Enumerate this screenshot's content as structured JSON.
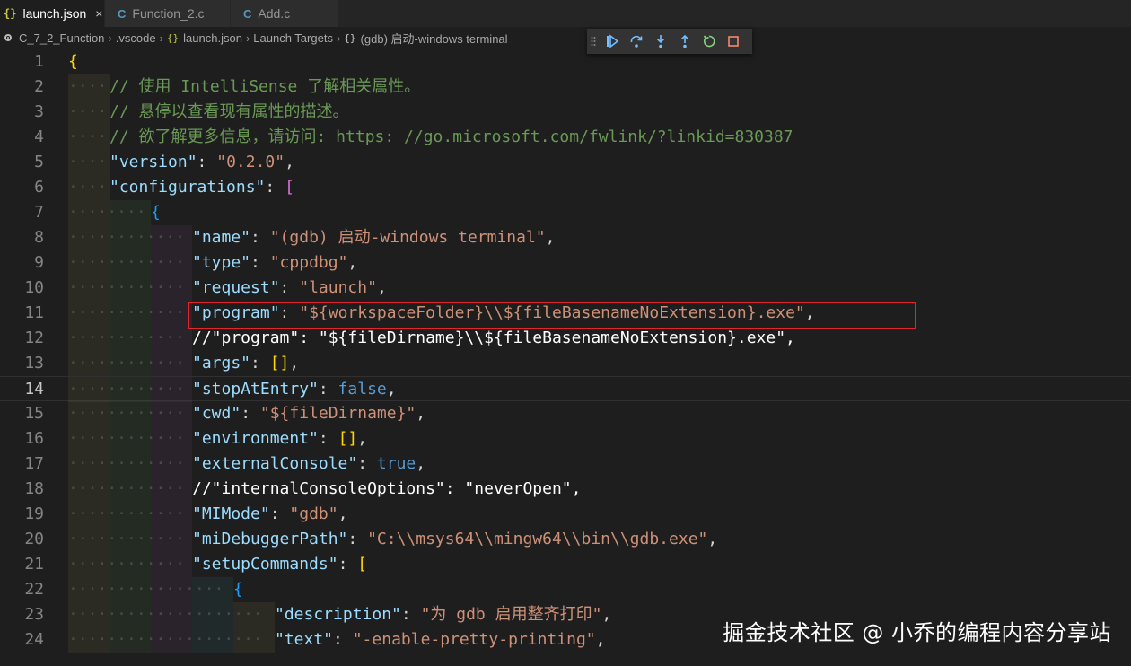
{
  "tabs": [
    {
      "label": "launch.json",
      "icon": "json-braces-icon",
      "icon_glyph": "{}",
      "active": true,
      "close": "×"
    },
    {
      "label": "Function_2.c",
      "icon": "c-file-icon",
      "icon_glyph": "C",
      "active": false
    },
    {
      "label": "Add.c",
      "icon": "c-file-icon",
      "icon_glyph": "C",
      "active": false
    }
  ],
  "breadcrumb": {
    "items": [
      "C_7_2_Function",
      ".vscode",
      "launch.json",
      "Launch Targets",
      "(gdb) 启动-windows terminal"
    ],
    "separator": "›",
    "json_glyph": "{}",
    "obj_glyph": "{}"
  },
  "debug_toolbar": {
    "buttons": [
      "continue",
      "step-over",
      "step-into",
      "step-out",
      "restart",
      "stop"
    ],
    "colors": {
      "blue": "#75beff",
      "green": "#89d185",
      "red": "#f48771"
    }
  },
  "editor": {
    "active_line": 14,
    "highlighted_line": 11,
    "lines": [
      {
        "n": "1",
        "indent": 0,
        "tokens": [
          [
            "b1",
            "{"
          ]
        ]
      },
      {
        "n": "2",
        "indent": 1,
        "tokens": [
          [
            "cm",
            "// 使用 IntelliSense 了解相关属性。"
          ]
        ]
      },
      {
        "n": "3",
        "indent": 1,
        "tokens": [
          [
            "cm",
            "// 悬停以查看现有属性的描述。"
          ]
        ]
      },
      {
        "n": "4",
        "indent": 1,
        "tokens": [
          [
            "cm",
            "// 欲了解更多信息，请访问: https: //go.microsoft.com/fwlink/?linkid=830387"
          ]
        ]
      },
      {
        "n": "5",
        "indent": 1,
        "tokens": [
          [
            "k",
            "\"version\""
          ],
          [
            "p",
            ": "
          ],
          [
            "s",
            "\"0.2.0\""
          ],
          [
            "p",
            ","
          ]
        ]
      },
      {
        "n": "6",
        "indent": 1,
        "tokens": [
          [
            "k",
            "\"configurations\""
          ],
          [
            "p",
            ": "
          ],
          [
            "b2",
            "["
          ]
        ]
      },
      {
        "n": "7",
        "indent": 2,
        "tokens": [
          [
            "b3",
            "{"
          ]
        ]
      },
      {
        "n": "8",
        "indent": 3,
        "tokens": [
          [
            "k",
            "\"name\""
          ],
          [
            "p",
            ": "
          ],
          [
            "s",
            "\"(gdb) 启动-windows terminal\""
          ],
          [
            "p",
            ","
          ]
        ]
      },
      {
        "n": "9",
        "indent": 3,
        "tokens": [
          [
            "k",
            "\"type\""
          ],
          [
            "p",
            ": "
          ],
          [
            "s",
            "\"cppdbg\""
          ],
          [
            "p",
            ","
          ]
        ]
      },
      {
        "n": "10",
        "indent": 3,
        "tokens": [
          [
            "k",
            "\"request\""
          ],
          [
            "p",
            ": "
          ],
          [
            "s",
            "\"launch\""
          ],
          [
            "p",
            ","
          ]
        ]
      },
      {
        "n": "11",
        "indent": 3,
        "tokens": [
          [
            "k",
            "\"program\""
          ],
          [
            "p",
            ": "
          ],
          [
            "s",
            "\"${workspaceFolder}\\\\${fileBasenameNoExtension}.exe\""
          ],
          [
            "p",
            ","
          ]
        ]
      },
      {
        "n": "12",
        "indent": 3,
        "tokens": [
          [
            "wt",
            "//\"program\": \"${fileDirname}\\\\${fileBasenameNoExtension}.exe\","
          ]
        ]
      },
      {
        "n": "13",
        "indent": 3,
        "tokens": [
          [
            "k",
            "\"args\""
          ],
          [
            "p",
            ": "
          ],
          [
            "b1",
            "[]"
          ],
          [
            "p",
            ","
          ]
        ]
      },
      {
        "n": "14",
        "indent": 3,
        "tokens": [
          [
            "k",
            "\"stopAtEntry\""
          ],
          [
            "p",
            ": "
          ],
          [
            "kw",
            "false"
          ],
          [
            "p",
            ","
          ]
        ]
      },
      {
        "n": "15",
        "indent": 3,
        "tokens": [
          [
            "k",
            "\"cwd\""
          ],
          [
            "p",
            ": "
          ],
          [
            "s",
            "\"${fileDirname}\""
          ],
          [
            "p",
            ","
          ]
        ]
      },
      {
        "n": "16",
        "indent": 3,
        "tokens": [
          [
            "k",
            "\"environment\""
          ],
          [
            "p",
            ": "
          ],
          [
            "b1",
            "[]"
          ],
          [
            "p",
            ","
          ]
        ]
      },
      {
        "n": "17",
        "indent": 3,
        "tokens": [
          [
            "k",
            "\"externalConsole\""
          ],
          [
            "p",
            ": "
          ],
          [
            "kw",
            "true"
          ],
          [
            "p",
            ","
          ]
        ]
      },
      {
        "n": "18",
        "indent": 3,
        "tokens": [
          [
            "wt",
            "//\"internalConsoleOptions\": \"neverOpen\","
          ]
        ]
      },
      {
        "n": "19",
        "indent": 3,
        "tokens": [
          [
            "k",
            "\"MIMode\""
          ],
          [
            "p",
            ": "
          ],
          [
            "s",
            "\"gdb\""
          ],
          [
            "p",
            ","
          ]
        ]
      },
      {
        "n": "20",
        "indent": 3,
        "tokens": [
          [
            "k",
            "\"miDebuggerPath\""
          ],
          [
            "p",
            ": "
          ],
          [
            "s",
            "\"C:\\\\msys64\\\\mingw64\\\\bin\\\\gdb.exe\""
          ],
          [
            "p",
            ","
          ]
        ]
      },
      {
        "n": "21",
        "indent": 3,
        "tokens": [
          [
            "k",
            "\"setupCommands\""
          ],
          [
            "p",
            ": "
          ],
          [
            "b1",
            "["
          ]
        ]
      },
      {
        "n": "22",
        "indent": 4,
        "tokens": [
          [
            "b3",
            "{"
          ]
        ]
      },
      {
        "n": "23",
        "indent": 5,
        "tokens": [
          [
            "k",
            "\"description\""
          ],
          [
            "p",
            ": "
          ],
          [
            "s",
            "\"为 gdb 启用整齐打印\""
          ],
          [
            "p",
            ","
          ]
        ]
      },
      {
        "n": "24",
        "indent": 5,
        "tokens": [
          [
            "k",
            "\"text\""
          ],
          [
            "p",
            ": "
          ],
          [
            "s",
            "\"-enable-pretty-printing\""
          ],
          [
            "p",
            ","
          ]
        ]
      }
    ]
  },
  "watermark": "掘金技术社区 @ 小乔的编程内容分享站"
}
